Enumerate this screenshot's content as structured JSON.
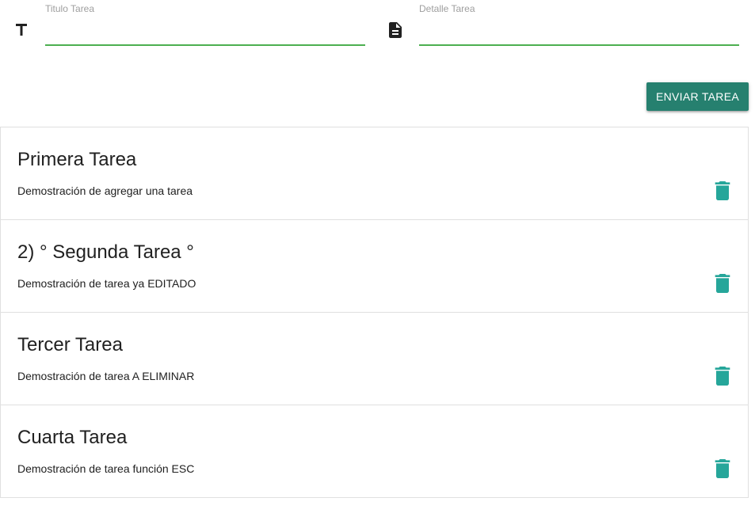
{
  "form": {
    "title_field": {
      "label": "Titulo Tarea",
      "value": "",
      "icon": "title-text-icon"
    },
    "detail_field": {
      "label": "Detalle Tarea",
      "value": "",
      "icon": "description-document-icon"
    },
    "submit_label": "ENVIAR TAREA"
  },
  "colors": {
    "accent_green": "#4caf50",
    "button_teal": "#26806f",
    "trash_teal": "#26a69a"
  },
  "tasks": [
    {
      "title": "Primera Tarea",
      "detail": "Demostración de agregar una tarea",
      "delete_icon": "trash-icon"
    },
    {
      "title": "2) ° Segunda Tarea °",
      "detail": "Demostración de tarea ya EDITADO",
      "delete_icon": "trash-icon"
    },
    {
      "title": "Tercer Tarea",
      "detail": "Demostración de tarea A ELIMINAR",
      "delete_icon": "trash-icon"
    },
    {
      "title": "Cuarta Tarea",
      "detail": "Demostración de tarea función ESC",
      "delete_icon": "trash-icon"
    }
  ]
}
